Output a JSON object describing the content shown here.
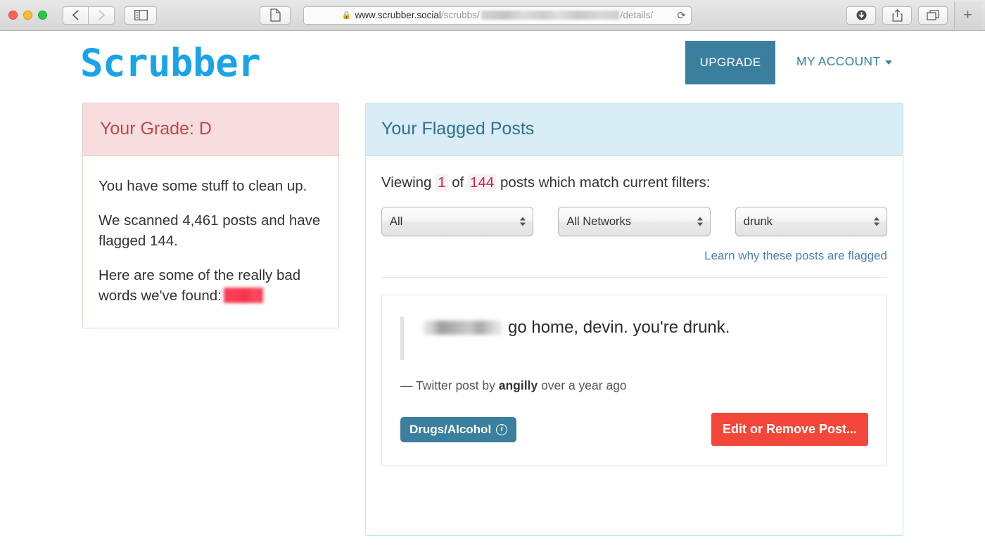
{
  "browser": {
    "back_icon": "chevron-left-icon",
    "forward_icon": "chevron-right-icon",
    "sidebar_icon": "sidebar-toggle-icon",
    "reader_icon": "reader-view-icon",
    "lock_icon": "lock-icon",
    "url_host": "www.scrubber.social",
    "url_path_prefix": "/scrubbs/",
    "url_path_suffix": "/details/",
    "reload_icon": "reload-icon",
    "download_icon": "download-icon",
    "share_icon": "share-icon",
    "tabs_icon": "show-tabs-icon",
    "new_tab_label": "+"
  },
  "header": {
    "logo": "Scrubber",
    "upgrade_label": "UPGRADE",
    "account_label": "MY ACCOUNT",
    "caret_icon": "chevron-down-icon"
  },
  "grade_panel": {
    "title": "Your Grade: D",
    "line1": "You have some stuff to clean up.",
    "line2": "We scanned 4,461 posts and have flagged 144.",
    "line3_prefix": "Here are some of the really bad words we've found:",
    "redacted_icon": "redacted-word-block"
  },
  "flagged_panel": {
    "title": "Your Flagged Posts",
    "viewing_prefix": "Viewing",
    "viewing_current": "1",
    "viewing_of": "of",
    "viewing_total": "144",
    "viewing_suffix": "posts which match current filters:",
    "filters": [
      {
        "name": "type-filter",
        "value": "All"
      },
      {
        "name": "network-filter",
        "value": "All Networks"
      },
      {
        "name": "keyword-filter",
        "value": "drunk"
      }
    ],
    "learn_link": "Learn why these posts are flagged",
    "post": {
      "redacted_handle_icon": "redacted-handle-block",
      "text": "go home, devin. you're drunk.",
      "attribution_prefix": "— Twitter post by",
      "attribution_author": "angilly",
      "attribution_suffix": "over a year ago",
      "badge_label": "Drugs/Alcohol",
      "badge_info_icon": "info-circle-icon",
      "action_label": "Edit or Remove Post..."
    }
  },
  "colors": {
    "brand_blue": "#1aa3e8",
    "teal": "#3a7f9d",
    "danger_red": "#f4473b",
    "grade_text": "#b94a48",
    "grade_bg": "#f7dddd",
    "panel_header_bg": "#d9edf7",
    "panel_header_text": "#31708f",
    "count_highlight": "#c7254e"
  }
}
